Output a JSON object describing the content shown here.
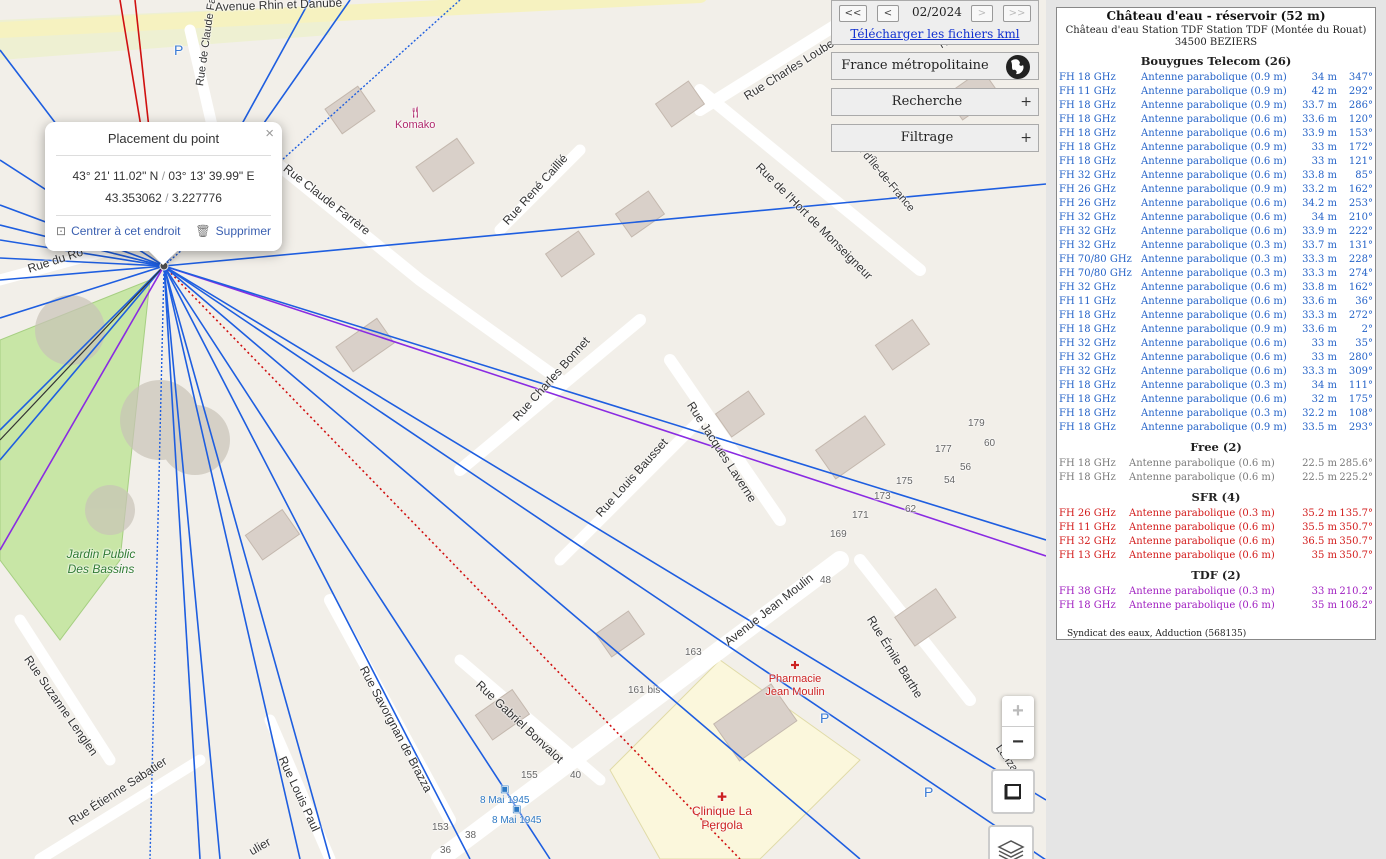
{
  "map": {
    "street_labels": [
      "Avenue Rhin et Danube",
      "Rue Charles Loubens",
      "Rue Claude Farrère",
      "Rue René Caillié",
      "Rue de l'Hort de Monseigneur",
      "Rue Charles Bonnet",
      "Rue Jacques Laverne",
      "Rue Louis Bausset",
      "Avenue Jean Moulin",
      "Rue Émile Barthe",
      "Rue Savorgnan de Brazza",
      "Rue Gabriel Bonvalot",
      "Rue Louis Paul",
      "Rue Étienne Sabatier",
      "Rue Suzanne Lenglen",
      "Rue du Ro",
      "Rue de Claude Farrère",
      "Rue d'Île-de-France",
      "Rue Gr",
      "Lanzas",
      "ulier"
    ],
    "places": {
      "komako": "Komako",
      "park": "Jardin Public Des Bassins",
      "pharmacy": "Pharmacie Jean Moulin",
      "clinic": "Clinique La Pergola",
      "bus_stop_1": "8 Mai 1945",
      "bus_stop_2": "8 Mai 1945",
      "parking": "P"
    },
    "house_numbers": [
      "179",
      "177",
      "60",
      "56",
      "54",
      "175",
      "173",
      "171",
      "62",
      "169",
      "48",
      "163",
      "161 bis",
      "155",
      "40",
      "153",
      "38",
      "36"
    ]
  },
  "popup": {
    "title": "Placement du point",
    "close": "×",
    "dms_lat": "43° 21' 11.02\" N",
    "dms_lon": "03° 13' 39.99\" E",
    "sep": "/",
    "dec_lat": "43.353062",
    "dec_lon": "3.227776",
    "center_label": "Centrer à cet endroit",
    "delete_label": "Supprimer"
  },
  "nav": {
    "first": "<<",
    "prev": "<",
    "date": "02/2024",
    "next": ">",
    "last": ">>",
    "kml": "Télécharger les fichiers kml",
    "region": "France métropolitaine",
    "search": "Recherche",
    "filter": "Filtrage",
    "plus": "+"
  },
  "controls": {
    "zoom_in": "+",
    "zoom_out": "−"
  },
  "info": {
    "title": "Château d'eau - réservoir (52 m)",
    "address1": "Château d'eau Station TDF Station TDF (Montée du Rouat)",
    "address2": "34500 BEZIERS",
    "footer": "Syndicat des eaux, Adduction (568135)",
    "operators": [
      {
        "name": "Bouygues Telecom (26)",
        "class": "blue",
        "rows": [
          [
            "FH 18 GHz",
            "Antenne parabolique (0.9 m)",
            "34 m",
            "347°"
          ],
          [
            "FH 11 GHz",
            "Antenne parabolique (0.9 m)",
            "42 m",
            "292°"
          ],
          [
            "FH 18 GHz",
            "Antenne parabolique (0.9 m)",
            "33.7 m",
            "286°"
          ],
          [
            "FH 18 GHz",
            "Antenne parabolique (0.6 m)",
            "33.6 m",
            "120°"
          ],
          [
            "FH 18 GHz",
            "Antenne parabolique (0.6 m)",
            "33.9 m",
            "153°"
          ],
          [
            "FH 18 GHz",
            "Antenne parabolique (0.9 m)",
            "33 m",
            "172°"
          ],
          [
            "FH 18 GHz",
            "Antenne parabolique (0.6 m)",
            "33 m",
            "121°"
          ],
          [
            "FH 32 GHz",
            "Antenne parabolique (0.6 m)",
            "33.8 m",
            "85°"
          ],
          [
            "FH 26 GHz",
            "Antenne parabolique (0.9 m)",
            "33.2 m",
            "162°"
          ],
          [
            "FH 26 GHz",
            "Antenne parabolique (0.6 m)",
            "34.2 m",
            "253°"
          ],
          [
            "FH 32 GHz",
            "Antenne parabolique (0.6 m)",
            "34 m",
            "210°"
          ],
          [
            "FH 32 GHz",
            "Antenne parabolique (0.6 m)",
            "33.9 m",
            "222°"
          ],
          [
            "FH 32 GHz",
            "Antenne parabolique (0.3 m)",
            "33.7 m",
            "131°"
          ],
          [
            "FH 70/80 GHz",
            "Antenne parabolique (0.3 m)",
            "33.3 m",
            "228°"
          ],
          [
            "FH 70/80 GHz",
            "Antenne parabolique (0.3 m)",
            "33.3 m",
            "274°"
          ],
          [
            "FH 32 GHz",
            "Antenne parabolique (0.6 m)",
            "33.8 m",
            "162°"
          ],
          [
            "FH 11 GHz",
            "Antenne parabolique (0.6 m)",
            "33.6 m",
            "36°"
          ],
          [
            "FH 18 GHz",
            "Antenne parabolique (0.6 m)",
            "33.3 m",
            "272°"
          ],
          [
            "FH 18 GHz",
            "Antenne parabolique (0.9 m)",
            "33.6 m",
            "2°"
          ],
          [
            "FH 32 GHz",
            "Antenne parabolique (0.6 m)",
            "33 m",
            "35°"
          ],
          [
            "FH 32 GHz",
            "Antenne parabolique (0.6 m)",
            "33 m",
            "280°"
          ],
          [
            "FH 32 GHz",
            "Antenne parabolique (0.6 m)",
            "33.3 m",
            "309°"
          ],
          [
            "FH 18 GHz",
            "Antenne parabolique (0.3 m)",
            "34 m",
            "111°"
          ],
          [
            "FH 18 GHz",
            "Antenne parabolique (0.6 m)",
            "32 m",
            "175°"
          ],
          [
            "FH 18 GHz",
            "Antenne parabolique (0.3 m)",
            "32.2 m",
            "108°"
          ],
          [
            "FH 18 GHz",
            "Antenne parabolique (0.9 m)",
            "33.5 m",
            "293°"
          ]
        ]
      },
      {
        "name": "Free (2)",
        "class": "grey",
        "rows": [
          [
            "FH 18 GHz",
            "Antenne parabolique (0.6 m)",
            "22.5 m",
            "285.6°"
          ],
          [
            "FH 18 GHz",
            "Antenne parabolique (0.6 m)",
            "22.5 m",
            "225.2°"
          ]
        ]
      },
      {
        "name": "SFR (4)",
        "class": "red",
        "rows": [
          [
            "FH 26 GHz",
            "Antenne parabolique (0.3 m)",
            "35.2 m",
            "135.7°"
          ],
          [
            "FH 11 GHz",
            "Antenne parabolique (0.6 m)",
            "35.5 m",
            "350.7°"
          ],
          [
            "FH 32 GHz",
            "Antenne parabolique (0.6 m)",
            "36.5 m",
            "350.7°"
          ],
          [
            "FH 13 GHz",
            "Antenne parabolique (0.6 m)",
            "35 m",
            "350.7°"
          ]
        ]
      },
      {
        "name": "TDF (2)",
        "class": "purple",
        "rows": [
          [
            "FH 38 GHz",
            "Antenne parabolique (0.3 m)",
            "33 m",
            "210.2°"
          ],
          [
            "FH 18 GHz",
            "Antenne parabolique (0.6 m)",
            "35 m",
            "108.2°"
          ]
        ]
      }
    ]
  }
}
